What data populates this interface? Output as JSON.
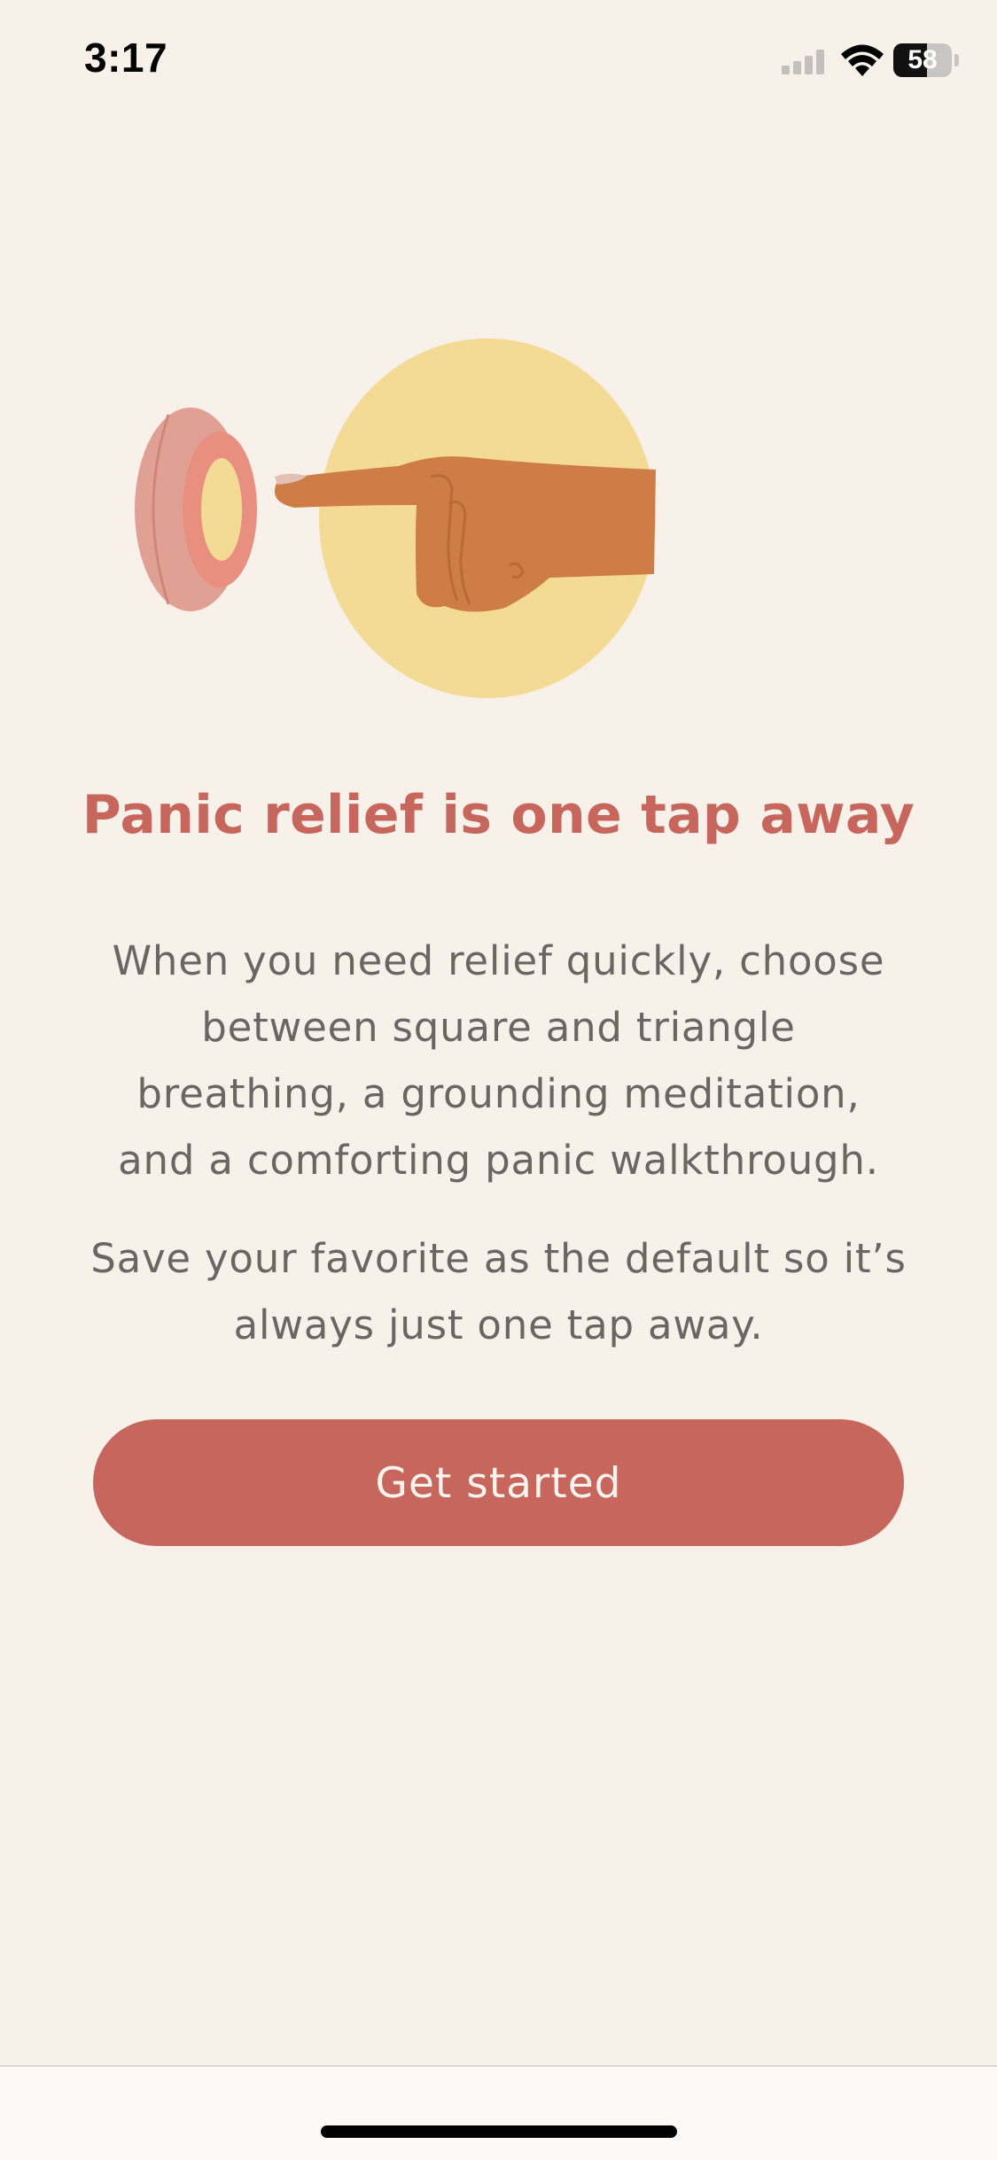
{
  "status_bar": {
    "time": "3:17",
    "battery_level": "58",
    "battery_fraction": 0.58,
    "icons": [
      "signal-icon",
      "wifi-icon",
      "battery-icon"
    ]
  },
  "illustration": {
    "icon": "finger-pressing-button-illustration",
    "colors": {
      "circle": "#f3db95",
      "hand": "#cd7d45",
      "button_outer": "#e29d8f",
      "button_inner": "#f3db95"
    }
  },
  "onboarding": {
    "title": "Panic relief is one tap away",
    "description_lines": [
      "When you need relief quickly, choose",
      "between square and triangle",
      "breathing, a grounding meditation,",
      "and a comforting panic walkthrough."
    ],
    "note_lines": [
      "Save your favorite as the default so it’s",
      "always just one tap away."
    ],
    "cta_label": "Get started"
  },
  "colors": {
    "background": "#f7f1e9",
    "accent": "#c7665c",
    "body_text": "#6b6664"
  }
}
